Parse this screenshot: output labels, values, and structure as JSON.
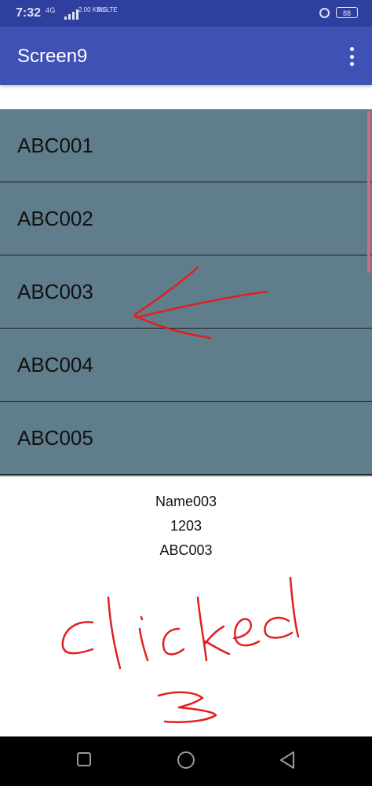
{
  "status_bar": {
    "time": "7:32",
    "network": "4G",
    "speed": "2.00 KB/S",
    "volte": "Vo LTE",
    "battery": "88"
  },
  "app_bar": {
    "title": "Screen9"
  },
  "list": {
    "items": [
      {
        "label": "ABC001"
      },
      {
        "label": "ABC002"
      },
      {
        "label": "ABC003"
      },
      {
        "label": "ABC004"
      },
      {
        "label": "ABC005"
      }
    ]
  },
  "details": {
    "name": "Name003",
    "number": "1203",
    "code": "ABC003"
  },
  "annotation": {
    "text": "clicked",
    "number": "3",
    "color": "#e02020"
  },
  "colors": {
    "app_bar": "#3f51b5",
    "status_bar": "#2f3f9e",
    "list_background": "#607d8b",
    "scroll_indicator": "#d06a8d"
  },
  "icons": {
    "overflow": "more-vertical-icon",
    "recents": "square-icon",
    "home": "circle-icon",
    "back": "triangle-back-icon"
  }
}
